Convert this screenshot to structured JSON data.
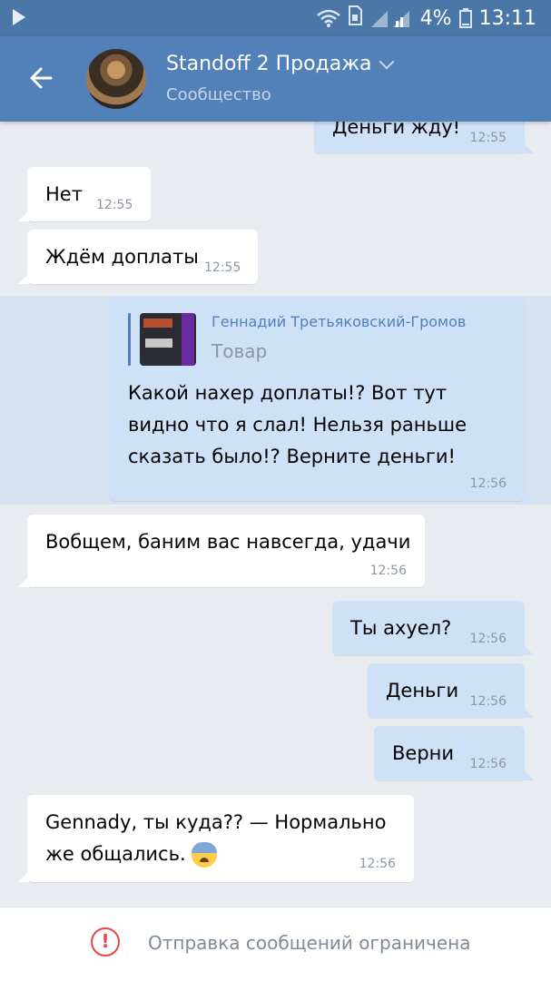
{
  "status_bar": {
    "battery": "4%",
    "time": "13:11"
  },
  "header": {
    "title": "Standoff 2 Продажа",
    "subtitle": "Сообщество"
  },
  "messages": [
    {
      "direction": "out",
      "text": "Деньги жду!",
      "time": "12:55"
    },
    {
      "direction": "in",
      "text": "Нет",
      "time": "12:55"
    },
    {
      "direction": "in",
      "text": "Ждём доплаты",
      "time": "12:55"
    },
    {
      "direction": "out",
      "reply_author": "Геннадий Третьяковский-Громов",
      "reply_text": "Товар",
      "text": "Какой нахер доплаты!? Вот тут видно что я слал! Нельзя раньше сказать было!? Верните деньги!",
      "time": "12:56"
    },
    {
      "direction": "in",
      "text": "Вобщем, баним вас навсегда, удачи",
      "time": "12:56"
    },
    {
      "direction": "out",
      "text": "Ты ахуел?",
      "time": "12:56"
    },
    {
      "direction": "out",
      "text": "Деньги",
      "time": "12:56"
    },
    {
      "direction": "out",
      "text": "Верни",
      "time": "12:56"
    },
    {
      "direction": "in",
      "text": "Gennady, ты куда?? — Нормально же общались.",
      "time": "12:56"
    }
  ],
  "bottom_bar": {
    "icon": "alert-circle-icon",
    "label": "Отправка сообщений ограничена"
  },
  "colors": {
    "header": "#5181b8",
    "status_bar": "#4a76a8",
    "outgoing_bubble": "#cfe1f6",
    "incoming_bubble": "#ffffff",
    "background": "#e8ecf1",
    "alert": "#e64646"
  }
}
